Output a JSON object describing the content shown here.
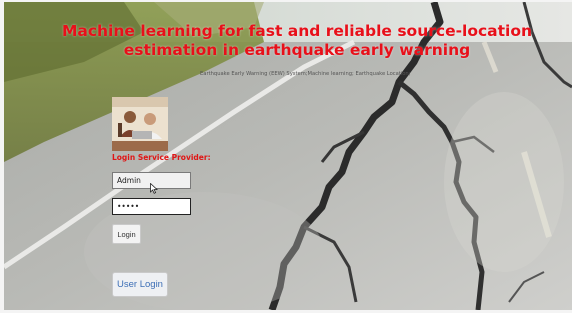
{
  "header": {
    "title": "Machine learning for fast and reliable source-location estimation in earthquake early warning",
    "subtitle": "Earthquake Early Warning (EEW) System;Machine learning; Earthquake Location;"
  },
  "login_panel": {
    "label": "Login Service Provider:",
    "username_value": "Admin",
    "password_value": "•••••",
    "login_button": "Login"
  },
  "user_login_button": "User Login",
  "colors": {
    "title": "#e8101a",
    "label": "#e01616",
    "user_login_text": "#3d6fb6"
  }
}
